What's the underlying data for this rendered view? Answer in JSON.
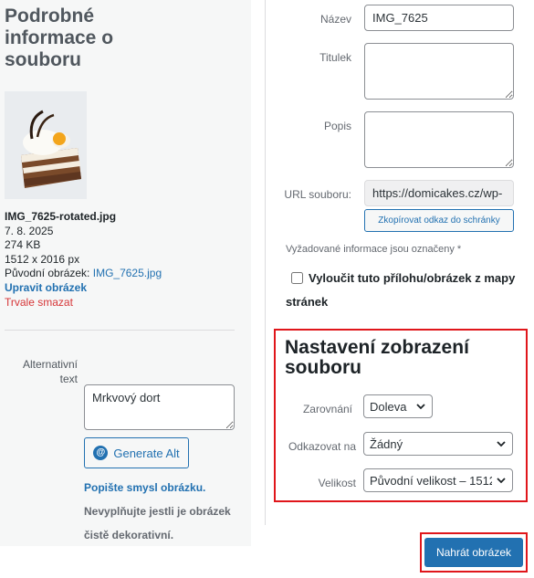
{
  "details": {
    "title": "Podrobné informace o souboru",
    "filename": "IMG_7625-rotated.jpg",
    "date": "7. 8. 2025",
    "size": "274 KB",
    "dimensions": "1512 x 2016 px",
    "original_label": "Původní obrázek:",
    "original_link": "IMG_7625.jpg",
    "edit_link": "Upravit obrázek",
    "delete_link": "Trvale smazat"
  },
  "alt": {
    "label": "Alternativní text",
    "value": "Mrkvový dort",
    "generate_label": "Generate Alt",
    "hint_link": "Popište smysl obrázku.",
    "hint_text": "Nevyplňujte jestli je obrázek čistě dekorativní."
  },
  "attachment": {
    "title_label": "Název",
    "title_value": "IMG_7625",
    "caption_label": "Titulek",
    "caption_value": "",
    "description_label": "Popis",
    "description_value": "",
    "url_label": "URL souboru:",
    "url_value": "https://domicakes.cz/wp-",
    "copy_label": "Zkopírovat odkaz do schránky",
    "required_note": "Vyžadované informace jsou označeny *",
    "exclude_label": "Vyloučit tuto přílohu/obrázek z mapy stránek"
  },
  "display": {
    "title": "Nastavení zobrazení souboru",
    "align_label": "Zarovnání",
    "align_value": "Doleva",
    "link_label": "Odkazovat na",
    "link_value": "Žádný",
    "size_label": "Velikost",
    "size_value": "Původní velikost – 1512"
  },
  "upload_label": "Nahrát obrázek"
}
